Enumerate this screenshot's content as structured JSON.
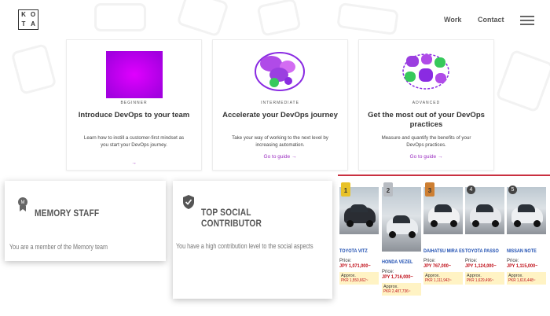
{
  "header": {
    "logo_letters": [
      "K",
      "O",
      "T",
      "A"
    ],
    "nav": [
      "Work",
      "Contact"
    ],
    "menu_icon": "hamburger-icon"
  },
  "guides": [
    {
      "level": "BEGINNER",
      "title": "Introduce DevOps to your team",
      "description": "Learn how to instill a customer-first mindset as you start your DevOps journey.",
      "link": "→",
      "colors": {
        "primary": "#c800e8",
        "secondary": "#8a2be2"
      }
    },
    {
      "level": "INTERMEDIATE",
      "title": "Accelerate your DevOps journey",
      "description": "Take your way of working to the next level by increasing automation.",
      "link": "Go to guide →",
      "colors": {
        "primary": "#9b3fe0",
        "secondary": "#37c95c"
      }
    },
    {
      "level": "ADVANCED",
      "title": "Get the most out of your DevOps practices",
      "description": "Measure and quantify the benefits of your DevOps practices.",
      "link": "Go to guide →",
      "colors": {
        "primary": "#9b3fe0",
        "secondary": "#37c95c"
      }
    }
  ],
  "badges": [
    {
      "icon": "memory-badge-icon",
      "title": "MEMORY STAFF",
      "description": "You are a member of the Memory team"
    },
    {
      "icon": "checkmark-shield-icon",
      "title": "TOP SOCIAL CONTRIBUTOR",
      "description": "You have a high contribution level to the social aspects"
    }
  ],
  "cars": {
    "price_label": "Price:",
    "approx_label": "Approx.",
    "items": [
      {
        "rank": "1",
        "name": "TOYOTA VITZ",
        "price": "JPY 1,071,000~",
        "approx": "PKR 1,550,662~",
        "color": "#2a2d33",
        "medal": "#e8c229"
      },
      {
        "rank": "2",
        "name": "HONDA VEZEL",
        "price": "JPY 1,716,000~",
        "approx": "PKR 2,487,736~",
        "color": "#e9ecef",
        "medal": "#b8bcc2"
      },
      {
        "rank": "3",
        "name": "DAIHATSU MIRA ES",
        "price": "JPY 767,000~",
        "approx": "PKR 1,111,943~",
        "color": "#f0f1f2",
        "medal": "#cd7f32"
      },
      {
        "rank": "4",
        "name": "TOYOTA PASSO",
        "price": "JPY 1,124,000~",
        "approx": "PKR 1,629,496~",
        "color": "#e6e8eb",
        "medal": "#444444"
      },
      {
        "rank": "5",
        "name": "NISSAN NOTE",
        "price": "JPY 1,115,000~",
        "approx": "PKR 1,616,448~",
        "color": "#eef0f2",
        "medal": "#444444"
      }
    ]
  }
}
